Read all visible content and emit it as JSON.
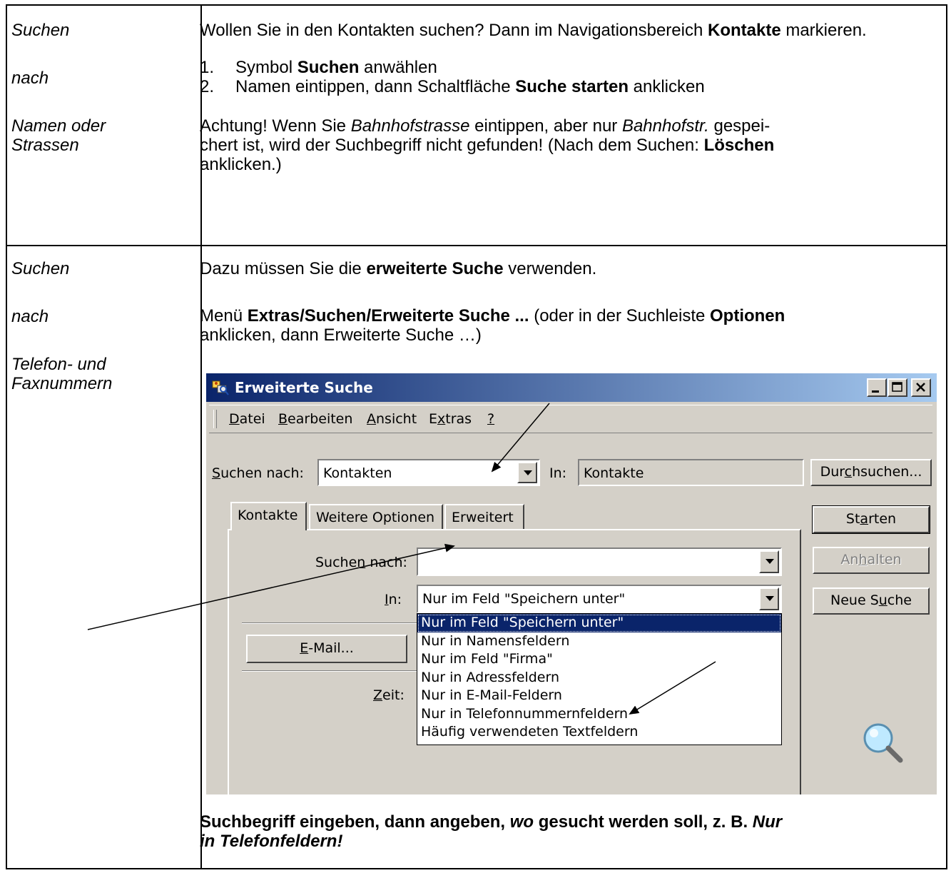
{
  "row1": {
    "left": [
      "Suchen",
      "nach",
      "Namen oder",
      "Strassen"
    ],
    "intro_pre": "Wollen Sie in den Kontakten suchen? Dann im Navigationsbereich ",
    "intro_bold": "Kontakte",
    "intro_post": " markieren.",
    "steps": [
      {
        "num": "1.",
        "pre": "Symbol ",
        "bold": "Suchen",
        "post": " anwählen"
      },
      {
        "num": "2.",
        "pre": "Namen eintippen, dann Schaltfläche ",
        "bold": "Suche starten",
        "post": " anklicken"
      }
    ],
    "note_1": "Achtung! Wenn Sie ",
    "note_italic_1": "Bahnhofstrasse",
    "note_2": " eintippen, aber nur ",
    "note_italic_2": "Bahnhofstr.",
    "note_3": " gespei-",
    "note_4": "chert ist, wird der Suchbegriff nicht gefunden! (Nach dem Suchen: ",
    "note_bold": "Löschen",
    "note_5": "anklicken.)"
  },
  "row2": {
    "left": [
      "Suchen",
      "nach",
      "Telefon- und",
      "Faxnummern"
    ],
    "p1_pre": "Dazu müssen Sie die ",
    "p1_bold": "erweiterte Suche",
    "p1_post": " verwenden.",
    "p2_pre": "Menü ",
    "p2_bold": "Extras/Suchen/Erweiterte Suche ...",
    "p2_mid": " (oder in der Suchleiste ",
    "p2_bold2": "Optionen",
    "p2_post": "anklicken, dann Erweiterte Suche …)",
    "footer_1": "Suchbegriff eingeben, dann angeben, ",
    "footer_italic": "wo",
    "footer_2": " gesucht werden soll, z. B. ",
    "footer_italic2a": "Nur",
    "footer_italic2b": "in Telefonfeldern!"
  },
  "dialog": {
    "title": "Erweiterte Suche",
    "menu": [
      {
        "u": "D",
        "rest": "atei"
      },
      {
        "u": "B",
        "rest": "earbeiten"
      },
      {
        "u": "A",
        "rest": "nsicht"
      },
      {
        "pre": "E",
        "u": "x",
        "rest": "tras"
      },
      {
        "u": "?",
        "rest": ""
      }
    ],
    "search_for_label_u": "S",
    "search_for_label_rest": "uchen nach:",
    "search_for_value": "Kontakten",
    "in_label": "In:",
    "in_value": "Kontakte",
    "browse_pre": "Dur",
    "browse_u": "c",
    "browse_post": "hsuchen...",
    "start_pre": "St",
    "start_u": "a",
    "start_post": "rten",
    "stop_pre": "An",
    "stop_u": "h",
    "stop_post": "alten",
    "new_pre": "Neue S",
    "new_u": "u",
    "new_post": "che",
    "tabs": [
      "Kontakte",
      "Weitere Optionen",
      "Erweitert"
    ],
    "term_label_pre": "Suche",
    "term_label_u": "n",
    "term_label_post": " nach:",
    "term_value": "",
    "in2_label_u": "I",
    "in2_label_rest": "n:",
    "in2_value": "Nur im Feld \"Speichern unter\"",
    "email_u": "E",
    "email_rest": "-Mail...",
    "time_label_u": "Z",
    "time_label_rest": "eit:",
    "options": [
      "Nur im Feld \"Speichern unter\"",
      "Nur in Namensfeldern",
      "Nur im Feld \"Firma\"",
      "Nur in Adressfeldern",
      "Nur in E-Mail-Feldern",
      "Nur in Telefonnummernfeldern",
      "Häufig verwendeten Textfeldern"
    ],
    "selected_option_index": 0,
    "icons": [
      "contacts-search-icon",
      "minimize-icon",
      "maximize-icon",
      "close-icon",
      "magnifier-icon"
    ],
    "colors": {
      "titlebar_start": "#0a246a",
      "titlebar_end": "#a6caf0",
      "face": "#d4d0c8",
      "selection": "#0a246a"
    }
  }
}
